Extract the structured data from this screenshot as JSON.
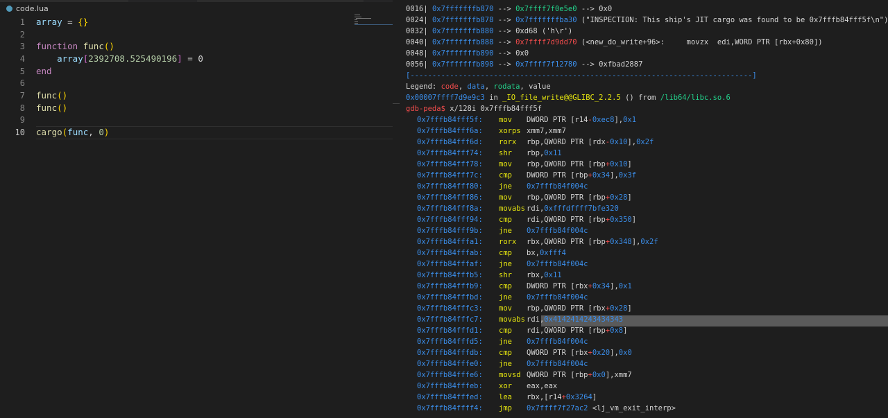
{
  "editor": {
    "tab_name": "code.lua",
    "line_numbers": [
      "1",
      "2",
      "3",
      "4",
      "5",
      "6",
      "7",
      "8",
      "9",
      "10"
    ],
    "code": {
      "l1_var": "array",
      "l1_eq": " = ",
      "l1_brace": "{}",
      "l3_kw": "function",
      "l3_fn": "func",
      "l3_paren": "()",
      "l4_var": "array",
      "l4_lb": "[",
      "l4_num": "2392708.525490196",
      "l4_rb": "]",
      "l4_rest": " = 0",
      "l5_kw": "end",
      "l7_fn": "func",
      "l7_paren": "()",
      "l8_fn": "func",
      "l8_paren": "()",
      "l10_fn": "cargo",
      "l10_lp": "(",
      "l10_arg": "func",
      "l10_comma": ", ",
      "l10_num": "0",
      "l10_rp": ")"
    }
  },
  "terminal": {
    "stack": [
      {
        "off": "0016|",
        "addr": "0x7fffffffb870",
        "arrow": " --> ",
        "val": "0x7ffff7f0e5e0",
        "rest": " --> 0x0"
      },
      {
        "off": "0024|",
        "addr": "0x7fffffffb878",
        "arrow": " --> ",
        "val": "0x7fffffffba30",
        "rest": " (\"INSPECTION: This ship's JIT cargo was found to be 0x7fffb84fff5f\\n\")"
      },
      {
        "off": "0032|",
        "addr": "0x7fffffffb880",
        "arrow": " --> ",
        "val": "0xd68",
        "rest": " ('h\\r')"
      },
      {
        "off": "0040|",
        "addr": "0x7fffffffb888",
        "arrow": " --> ",
        "val": "0x7ffff7d9dd70",
        "rest": " (<new_do_write+96>:     movzx  edi,WORD PTR [rbx+0x80])"
      },
      {
        "off": "0048|",
        "addr": "0x7fffffffb890",
        "arrow": " --> ",
        "val": "0x0",
        "rest": ""
      },
      {
        "off": "0056|",
        "addr": "0x7fffffffb898",
        "arrow": " --> ",
        "val": "0x7ffff7f12780",
        "rest": " --> 0xfbad2887"
      }
    ],
    "separator": "[------------------------------------------------------------------------------]",
    "legend": {
      "label": "Legend: ",
      "code": "code",
      "data": "data",
      "rodata": "rodata",
      "value": "value"
    },
    "stopped_addr": "0x00007ffff7d9e9c3",
    "stopped_in": " in ",
    "stopped_fn": "_IO_file_write@@GLIBC_2.2.5",
    "stopped_from": " () from ",
    "stopped_lib": "/lib64/libc.so.6",
    "prompt": "gdb-peda$",
    "command": " x/128i 0x7fffb84fff5f",
    "instructions": [
      {
        "addr": "0x7fffb84fff5f:",
        "mn": "mov",
        "op": "DWORD PTR [r14-0xec8],0x1"
      },
      {
        "addr": "0x7fffb84fff6a:",
        "mn": "xorps",
        "op": "xmm7,xmm7"
      },
      {
        "addr": "0x7fffb84fff6d:",
        "mn": "rorx",
        "op": "rbp,QWORD PTR [rdx-0x10],0x2f"
      },
      {
        "addr": "0x7fffb84fff74:",
        "mn": "shr",
        "op": "rbp,0x11"
      },
      {
        "addr": "0x7fffb84fff78:",
        "mn": "mov",
        "op": "rbp,QWORD PTR [rbp+0x10]"
      },
      {
        "addr": "0x7fffb84fff7c:",
        "mn": "cmp",
        "op": "DWORD PTR [rbp+0x34],0x3f"
      },
      {
        "addr": "0x7fffb84fff80:",
        "mn": "jne",
        "op": "0x7fffb84f004c"
      },
      {
        "addr": "0x7fffb84fff86:",
        "mn": "mov",
        "op": "rbp,QWORD PTR [rbp+0x28]"
      },
      {
        "addr": "0x7fffb84fff8a:",
        "mn": "movabs",
        "op": "rdi,0xfffdffff7bfe320"
      },
      {
        "addr": "0x7fffb84fff94:",
        "mn": "cmp",
        "op": "rdi,QWORD PTR [rbp+0x350]"
      },
      {
        "addr": "0x7fffb84fff9b:",
        "mn": "jne",
        "op": "0x7fffb84f004c"
      },
      {
        "addr": "0x7fffb84fffa1:",
        "mn": "rorx",
        "op": "rbx,QWORD PTR [rbp+0x348],0x2f"
      },
      {
        "addr": "0x7fffb84fffab:",
        "mn": "cmp",
        "op": "bx,0xfff4"
      },
      {
        "addr": "0x7fffb84fffaf:",
        "mn": "jne",
        "op": "0x7fffb84f004c"
      },
      {
        "addr": "0x7fffb84fffb5:",
        "mn": "shr",
        "op": "rbx,0x11"
      },
      {
        "addr": "0x7fffb84fffb9:",
        "mn": "cmp",
        "op": "DWORD PTR [rbx+0x34],0x1"
      },
      {
        "addr": "0x7fffb84fffbd:",
        "mn": "jne",
        "op": "0x7fffb84f004c"
      },
      {
        "addr": "0x7fffb84fffc3:",
        "mn": "mov",
        "op": "rbp,QWORD PTR [rbx+0x28]"
      },
      {
        "addr": "0x7fffb84fffc7:",
        "mn": "movabs",
        "op": "rdi,0x4142414243434343"
      },
      {
        "addr": "0x7fffb84fffd1:",
        "mn": "cmp",
        "op": "rdi,QWORD PTR [rbp+0x8]"
      },
      {
        "addr": "0x7fffb84fffd5:",
        "mn": "jne",
        "op": "0x7fffb84f004c"
      },
      {
        "addr": "0x7fffb84fffdb:",
        "mn": "cmp",
        "op": "QWORD PTR [rbx+0x20],0x0"
      },
      {
        "addr": "0x7fffb84fffe0:",
        "mn": "jne",
        "op": "0x7fffb84f004c"
      },
      {
        "addr": "0x7fffb84fffe6:",
        "mn": "movsd",
        "op": "QWORD PTR [rbp+0x0],xmm7"
      },
      {
        "addr": "0x7fffb84fffeb:",
        "mn": "xor",
        "op": "eax,eax"
      },
      {
        "addr": "0x7fffb84fffed:",
        "mn": "lea",
        "op": "rbx,[r14+0x3264]"
      },
      {
        "addr": "0x7fffb84ffff4:",
        "mn": "jmp",
        "op": "0x7ffff7f27ac2 <lj_vm_exit_interp>"
      }
    ]
  }
}
